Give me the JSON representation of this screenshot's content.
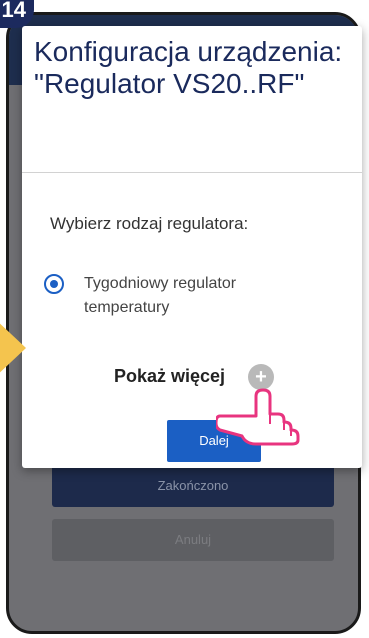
{
  "step_badge": "14",
  "dialog": {
    "title": "Konfiguracja urządzenia: \"Regulator VS20..RF\"",
    "prompt": "Wybierz rodzaj regulatora:",
    "option_label": "Tygodniowy regulator temperatury",
    "option_selected": true,
    "show_more_label": "Pokaż więcej",
    "next_label": "Dalej"
  },
  "background": {
    "primary_label": "Zakończono",
    "secondary_label": "Anuluj"
  },
  "colors": {
    "accent": "#1b5fc4",
    "title": "#1a2a5c",
    "arrow": "#f4c44e",
    "hand": "#e8347f"
  },
  "icons": {
    "plus": "plus-circle-icon",
    "pointer": "hand-pointer-icon",
    "arrow": "arrow-right-icon"
  }
}
